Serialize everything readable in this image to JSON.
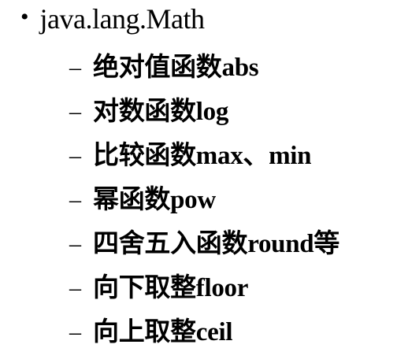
{
  "slide": {
    "bullet_glyph": "•",
    "title": "java.lang.Math",
    "dash_glyph": "–",
    "items": [
      "绝对值函数abs",
      "对数函数log",
      "比较函数max、min",
      "幂函数pow",
      "四舍五入函数round等",
      "向下取整floor",
      "向上取整ceil"
    ]
  }
}
